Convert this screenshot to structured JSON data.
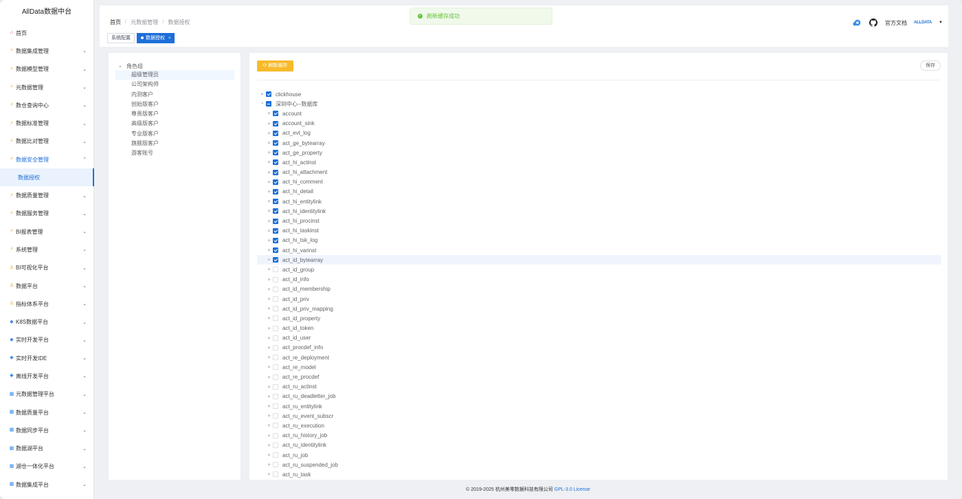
{
  "app": {
    "title": "AllData数据中台"
  },
  "sidebar": {
    "items": [
      {
        "label": "首页",
        "icon": "home-icon",
        "expandable": false
      },
      {
        "label": "数据集成管理",
        "icon": "bolt-icon",
        "expandable": true
      },
      {
        "label": "数据模型管理",
        "icon": "bolt-icon",
        "expandable": true
      },
      {
        "label": "元数据管理",
        "icon": "bolt-icon",
        "expandable": true
      },
      {
        "label": "数仓查询中心",
        "icon": "bolt-icon",
        "expandable": true
      },
      {
        "label": "数据标准管理",
        "icon": "bolt-icon",
        "expandable": true
      },
      {
        "label": "数据比对管理",
        "icon": "bolt-icon",
        "expandable": true
      },
      {
        "label": "数据安全管理",
        "icon": "bolt-icon",
        "expandable": true,
        "open": true
      },
      {
        "label": "数据质量管理",
        "icon": "bolt-icon",
        "expandable": true
      },
      {
        "label": "数据服务管理",
        "icon": "bolt-icon",
        "expandable": true
      },
      {
        "label": "BI报表管理",
        "icon": "bolt-icon",
        "expandable": true
      },
      {
        "label": "系统管理",
        "icon": "bolt-icon",
        "expandable": true
      },
      {
        "label": "BI可视化平台",
        "icon": "person-icon",
        "expandable": true
      },
      {
        "label": "数据平台",
        "icon": "person-icon",
        "expandable": true
      },
      {
        "label": "指标体系平台",
        "icon": "person-icon",
        "expandable": true
      },
      {
        "label": "K8S数据平台",
        "icon": "diamond-icon",
        "expandable": true
      },
      {
        "label": "实时开发平台",
        "icon": "diamond-icon",
        "expandable": true
      },
      {
        "label": "实时开发IDE",
        "icon": "diamond-icon",
        "expandable": true
      },
      {
        "label": "离线开发平台",
        "icon": "diamond-icon",
        "expandable": true
      },
      {
        "label": "元数据管理平台",
        "icon": "grid-icon",
        "expandable": true
      },
      {
        "label": "数据质量平台",
        "icon": "grid-icon",
        "expandable": true
      },
      {
        "label": "数据同步平台",
        "icon": "grid-icon",
        "expandable": true
      },
      {
        "label": "数据湖平台",
        "icon": "grid-icon",
        "expandable": true
      },
      {
        "label": "湖仓一体化平台",
        "icon": "grid-icon",
        "expandable": true
      },
      {
        "label": "数据集成平台",
        "icon": "grid-icon",
        "expandable": true
      }
    ],
    "active_sub": "数据授权"
  },
  "header": {
    "breadcrumb": [
      "首页",
      "元数据管理",
      "数据授权"
    ],
    "toast": "刷新缓存成功",
    "docs_label": "官方文档",
    "avatar_text": "ALLDATA"
  },
  "tags": [
    {
      "label": "系统配置",
      "active": false
    },
    {
      "label": "数据授权",
      "active": true
    }
  ],
  "roles": {
    "root": "角色组",
    "items": [
      "超级管理员",
      "公司架构师",
      "内测客户",
      "创始版客户",
      "尊贵版客户",
      "高级版客户",
      "专业版客户",
      "旗舰版客户",
      "游客账号"
    ],
    "selected_index": 0
  },
  "toolbar": {
    "refresh_label": "刷新缓存",
    "save_label": "保存"
  },
  "tree": {
    "roots": [
      {
        "label": "clickhouse",
        "state": "checked",
        "expanded": false
      },
      {
        "label": "深圳中心--数据库",
        "state": "half",
        "expanded": true
      }
    ],
    "tables": [
      {
        "label": "account",
        "checked": true
      },
      {
        "label": "account_sink",
        "checked": true
      },
      {
        "label": "act_evt_log",
        "checked": true
      },
      {
        "label": "act_ge_bytearray",
        "checked": true
      },
      {
        "label": "act_ge_property",
        "checked": true
      },
      {
        "label": "act_hi_actinst",
        "checked": true
      },
      {
        "label": "act_hi_attachment",
        "checked": true
      },
      {
        "label": "act_hi_comment",
        "checked": true
      },
      {
        "label": "act_hi_detail",
        "checked": true
      },
      {
        "label": "act_hi_entitylink",
        "checked": true
      },
      {
        "label": "act_hi_identitylink",
        "checked": true
      },
      {
        "label": "act_hi_procinst",
        "checked": true
      },
      {
        "label": "act_hi_taskinst",
        "checked": true
      },
      {
        "label": "act_hi_tsk_log",
        "checked": true
      },
      {
        "label": "act_hi_varinst",
        "checked": true
      },
      {
        "label": "act_id_bytearray",
        "checked": true,
        "highlight": true
      },
      {
        "label": "act_id_group",
        "checked": false
      },
      {
        "label": "act_id_info",
        "checked": false
      },
      {
        "label": "act_id_membership",
        "checked": false
      },
      {
        "label": "act_id_priv",
        "checked": false
      },
      {
        "label": "act_id_priv_mapping",
        "checked": false
      },
      {
        "label": "act_id_property",
        "checked": false
      },
      {
        "label": "act_id_token",
        "checked": false
      },
      {
        "label": "act_id_user",
        "checked": false
      },
      {
        "label": "act_procdef_info",
        "checked": false
      },
      {
        "label": "act_re_deployment",
        "checked": false
      },
      {
        "label": "act_re_model",
        "checked": false
      },
      {
        "label": "act_re_procdef",
        "checked": false
      },
      {
        "label": "act_ru_actinst",
        "checked": false
      },
      {
        "label": "act_ru_deadletter_job",
        "checked": false
      },
      {
        "label": "act_ru_entitylink",
        "checked": false
      },
      {
        "label": "act_ru_event_subscr",
        "checked": false
      },
      {
        "label": "act_ru_execution",
        "checked": false
      },
      {
        "label": "act_ru_history_job",
        "checked": false
      },
      {
        "label": "act_ru_identitylink",
        "checked": false
      },
      {
        "label": "act_ru_job",
        "checked": false
      },
      {
        "label": "act_ru_suspended_job",
        "checked": false
      },
      {
        "label": "act_ru_task",
        "checked": false
      }
    ]
  },
  "footer": {
    "copyright": "© 2019-2025 杭州美零数据科技有限公司",
    "license": "GPL-3.0 License"
  }
}
